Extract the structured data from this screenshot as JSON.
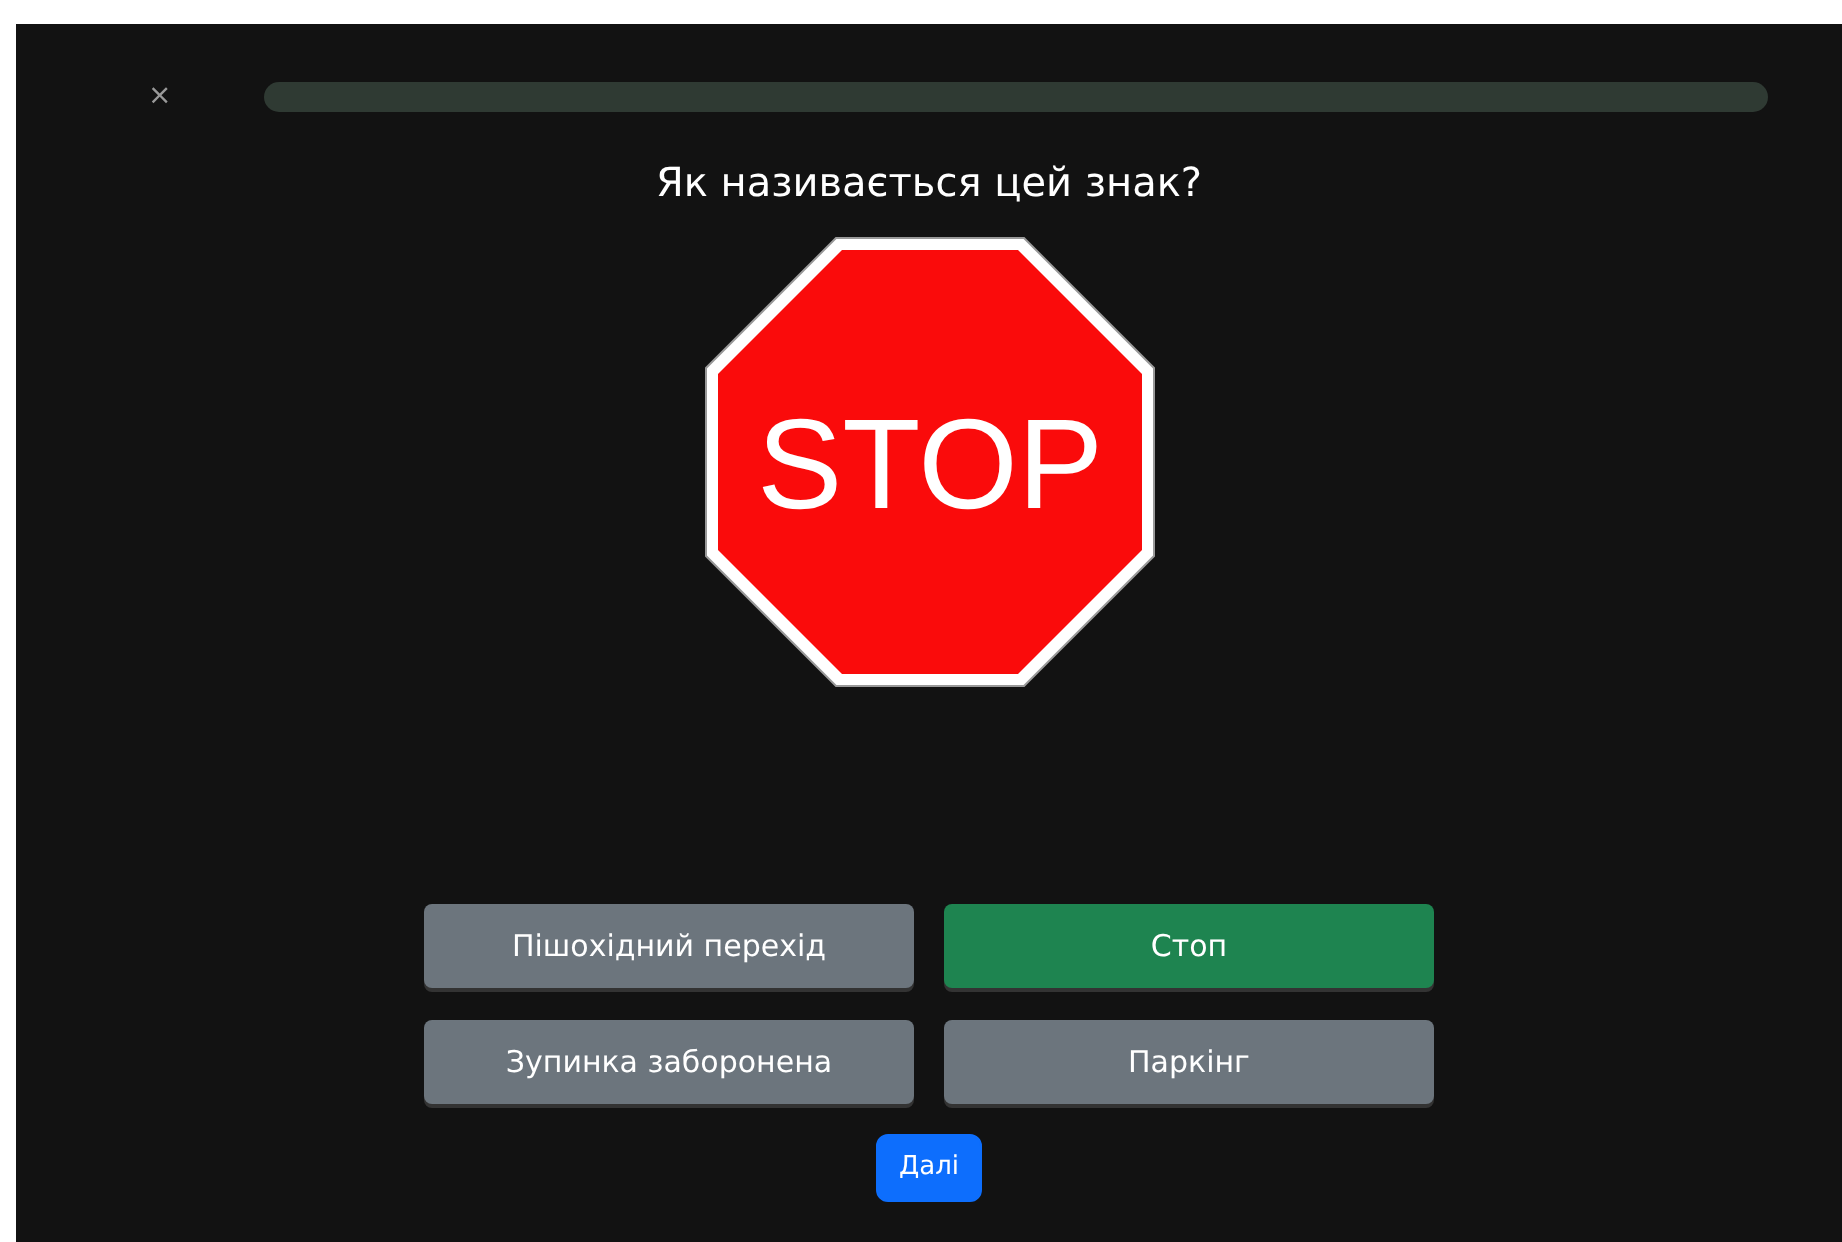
{
  "close": "×",
  "progress": {
    "level": 0
  },
  "question": "Як називається цей знак?",
  "sign": {
    "text": "STOP"
  },
  "answers": [
    {
      "label": "Пішохідний перехід",
      "correct": false
    },
    {
      "label": "Стоп",
      "correct": true
    },
    {
      "label": "Зупинка заборонена",
      "correct": false
    },
    {
      "label": "Паркінг",
      "correct": false
    }
  ],
  "next_button": "Далі"
}
